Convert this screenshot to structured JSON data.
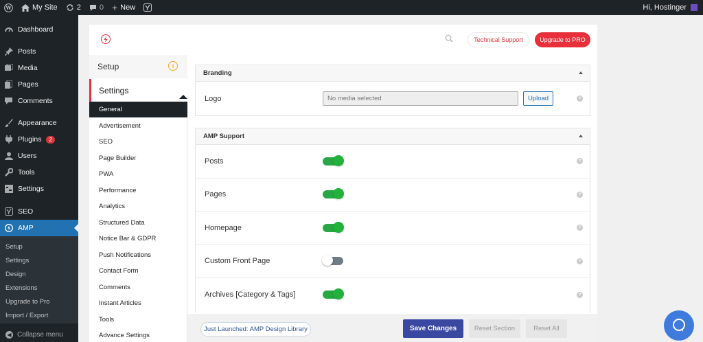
{
  "admin_bar": {
    "site_name": "My Site",
    "updates_count": "2",
    "comments_count": "0",
    "new_label": "New",
    "greeting": "Hi, Hostinger"
  },
  "admin_menu": {
    "items": [
      {
        "label": "Dashboard",
        "icon": "dashboard-icon"
      },
      {
        "label": "Posts",
        "icon": "pin-icon"
      },
      {
        "label": "Media",
        "icon": "media-icon"
      },
      {
        "label": "Pages",
        "icon": "page-icon"
      },
      {
        "label": "Comments",
        "icon": "comment-icon"
      },
      {
        "label": "Appearance",
        "icon": "brush-icon"
      },
      {
        "label": "Plugins",
        "icon": "plugin-icon",
        "badge": "2"
      },
      {
        "label": "Users",
        "icon": "user-icon"
      },
      {
        "label": "Tools",
        "icon": "wrench-icon"
      },
      {
        "label": "Settings",
        "icon": "settings-icon"
      },
      {
        "label": "SEO",
        "icon": "yoast-icon"
      },
      {
        "label": "AMP",
        "icon": "amp-icon",
        "active": true
      }
    ],
    "submenu": [
      "Setup",
      "Settings",
      "Design",
      "Extensions",
      "Upgrade to Pro",
      "Import / Export"
    ],
    "collapse_label": "Collapse menu"
  },
  "plugin_header": {
    "support_label": "Technical Support",
    "upgrade_label": "Upgrade to PRO"
  },
  "plugin_nav": {
    "setup_label": "Setup",
    "settings_label": "Settings",
    "items": [
      "General",
      "Advertisement",
      "SEO",
      "Page Builder",
      "PWA",
      "Performance",
      "Analytics",
      "Structured Data",
      "Notice Bar & GDPR",
      "Push Notifications",
      "Contact Form",
      "Comments",
      "Instant Articles",
      "Tools",
      "Advance Settings"
    ],
    "active_item": "General"
  },
  "branding": {
    "title": "Branding",
    "logo_label": "Logo",
    "media_placeholder": "No media selected",
    "upload_label": "Upload"
  },
  "amp_support": {
    "title": "AMP Support",
    "rows": [
      {
        "label": "Posts",
        "enabled": true
      },
      {
        "label": "Pages",
        "enabled": true
      },
      {
        "label": "Homepage",
        "enabled": true
      },
      {
        "label": "Custom Front Page",
        "enabled": false
      },
      {
        "label": "Archives [Category & Tags]",
        "enabled": true
      }
    ]
  },
  "footer": {
    "library_label": "Just Launched: AMP Design Library",
    "save_label": "Save Changes",
    "reset_section_label": "Reset Section",
    "reset_all_label": "Reset All"
  },
  "colors": {
    "accent_red": "#e8303a",
    "toggle_on": "#20b23a",
    "wp_blue": "#2271b1",
    "save_blue": "#3b48a1"
  }
}
